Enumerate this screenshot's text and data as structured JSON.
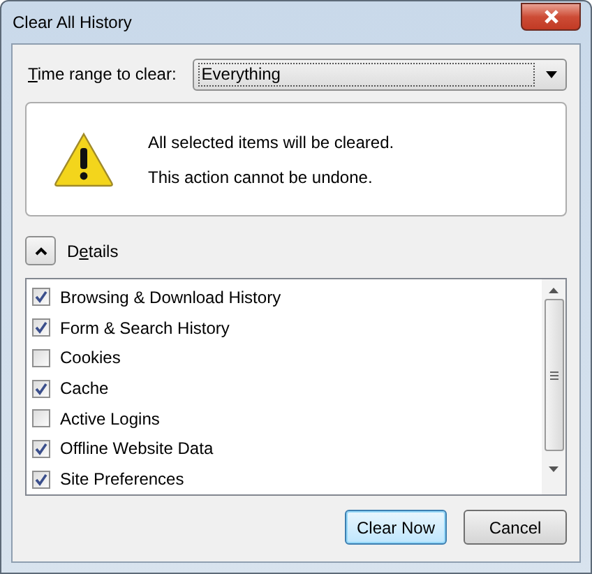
{
  "window": {
    "title": "Clear All History"
  },
  "time_range": {
    "label": {
      "key": "T",
      "after": "ime range to clear:"
    },
    "value": "Everything"
  },
  "warning": {
    "lines": [
      "All selected items will be cleared.",
      "This action cannot be undone."
    ]
  },
  "details": {
    "expanded": true,
    "label": {
      "before": "D",
      "key": "e",
      "after": "tails"
    }
  },
  "items": [
    {
      "label": "Browsing & Download History",
      "checked": true
    },
    {
      "label": "Form & Search History",
      "checked": true
    },
    {
      "label": "Cookies",
      "checked": false
    },
    {
      "label": "Cache",
      "checked": true
    },
    {
      "label": "Active Logins",
      "checked": false
    },
    {
      "label": "Offline Website Data",
      "checked": true
    },
    {
      "label": "Site Preferences",
      "checked": true
    }
  ],
  "buttons": [
    {
      "label": "Clear Now",
      "default": true
    },
    {
      "label": "Cancel",
      "default": false
    }
  ]
}
